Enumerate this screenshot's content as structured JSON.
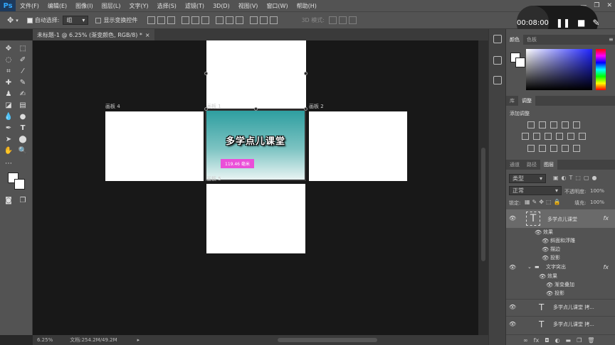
{
  "app": {
    "logo": "Ps"
  },
  "menu": [
    "文件(F)",
    "编辑(E)",
    "图像(I)",
    "图层(L)",
    "文字(Y)",
    "选择(S)",
    "滤镜(T)",
    "3D(D)",
    "视图(V)",
    "窗口(W)",
    "帮助(H)"
  ],
  "window_controls": {
    "minimize": "—",
    "restore": "❐",
    "close": "✕"
  },
  "options": {
    "auto_select_label": "自动选择:",
    "auto_select_value": "组",
    "show_transform_label": "显示变换控件",
    "mode_3d_label": "3D 模式:"
  },
  "recorder": {
    "time": "00:08:00"
  },
  "document": {
    "tab_title": "未标题-1 @ 6.25% (渐变颜色, RGB/8) *",
    "close_glyph": "×"
  },
  "artboards": {
    "label_1": "画板 1",
    "label_2": "画板 2",
    "label_4": "画板 4",
    "label_5": "画板 5",
    "title_text": "多学点儿课堂",
    "size_badge": "119.46 毫米"
  },
  "status": {
    "zoom": "6.25%",
    "doc_info": "文档:254.2M/49.2M"
  },
  "color_panel": {
    "tab_color": "颜色",
    "tab_swatches": "色板"
  },
  "adjust_panel": {
    "tab_library": "库",
    "tab_adjust": "调整",
    "title": "添加调整"
  },
  "layers_panel": {
    "tab_channels": "通道",
    "tab_paths": "路径",
    "tab_layers": "图层",
    "filter_kind": "类型",
    "blend_mode": "正常",
    "opacity_label": "不透明度:",
    "opacity_value": "100%",
    "lock_label": "锁定:",
    "fill_label": "填充:",
    "fill_value": "100%",
    "layers": [
      {
        "name": "多学点儿课堂"
      },
      {
        "name": "效果"
      },
      {
        "name": "斜面和浮雕"
      },
      {
        "name": "描边"
      },
      {
        "name": "投影"
      },
      {
        "name": "文字突出"
      },
      {
        "name": "效果"
      },
      {
        "name": "渐变叠加"
      },
      {
        "name": "投影"
      },
      {
        "name": "多学点儿课堂 拷..."
      },
      {
        "name": "多学点儿课堂 拷..."
      }
    ],
    "fx_label": "fx"
  },
  "colors": {
    "accent_badge": "#ea4fd8",
    "artboard_teal": "#2e9ea0"
  }
}
